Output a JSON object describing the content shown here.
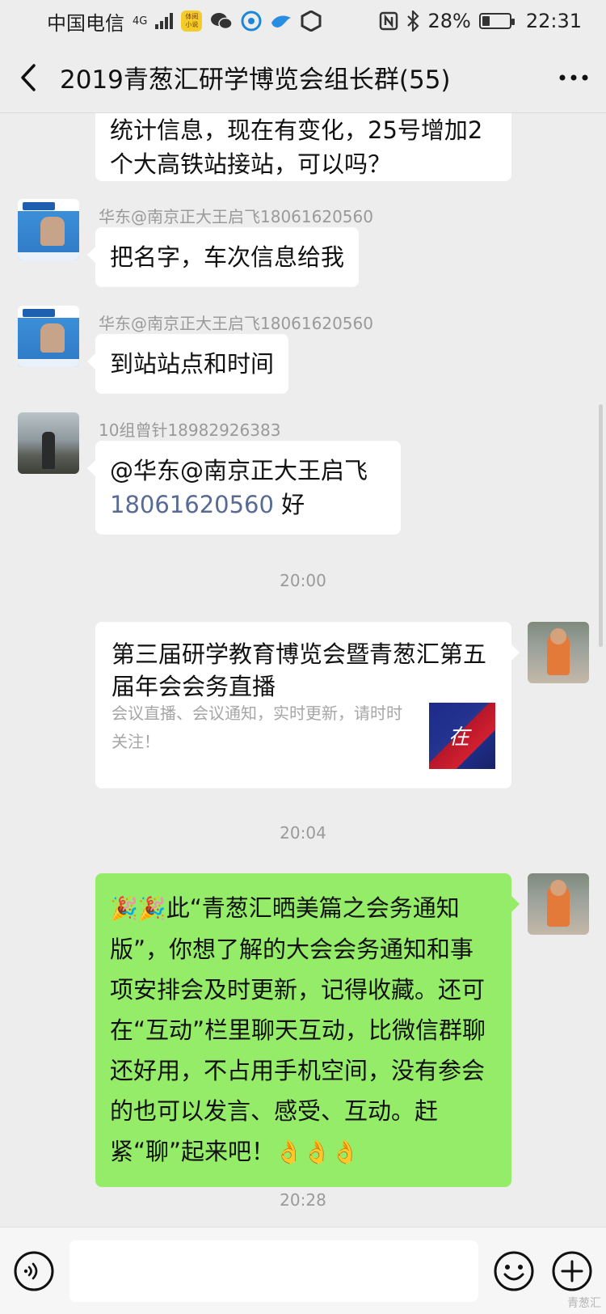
{
  "status_bar": {
    "carrier": "中国电信",
    "network": "4G",
    "app_badge": "体阅\n小说",
    "battery": "28%",
    "battery_level": 0.28,
    "time": "22:31"
  },
  "header": {
    "title": "2019青葱汇研学博览会组长群(55)"
  },
  "messages": {
    "m0_text": "统计信息，现在有变化，25号增加2个大高铁站接站，可以吗？",
    "m1_sender": "华东@南京正大王启飞18061620560",
    "m1_text": "把名字，车次信息给我",
    "m2_sender": "华东@南京正大王启飞18061620560",
    "m2_text": "到站站点和时间",
    "m3_sender": "10组曾针18982926383",
    "m3_text_a": "@华东@南京正大王启飞",
    "m3_number": "18061620560",
    "m3_text_b": " 好",
    "ts1": "20:00",
    "card_title": "第三届研学教育博览会暨青葱汇第五届年会会务直播",
    "card_desc": "会议直播、会议通知，实时更新，请时时关注！",
    "card_thumb_text": "在",
    "ts2": "20:04",
    "m5_emoji_prefix": "🎉🎉",
    "m5_text": "此“青葱汇晒美篇之会务通知版”，你想了解的大会会务通知和事项安排会及时更新，记得收藏。还可在“互动”栏里聊天互动，比微信群聊还好用，不占用手机空间，没有参会的也可以发言、感受、互动。赶紧“聊”起来吧！",
    "m5_emoji_suffix": "👌👌👌",
    "ts3": "20:28"
  },
  "input_bar": {
    "value": ""
  },
  "watermark": "青葱汇"
}
